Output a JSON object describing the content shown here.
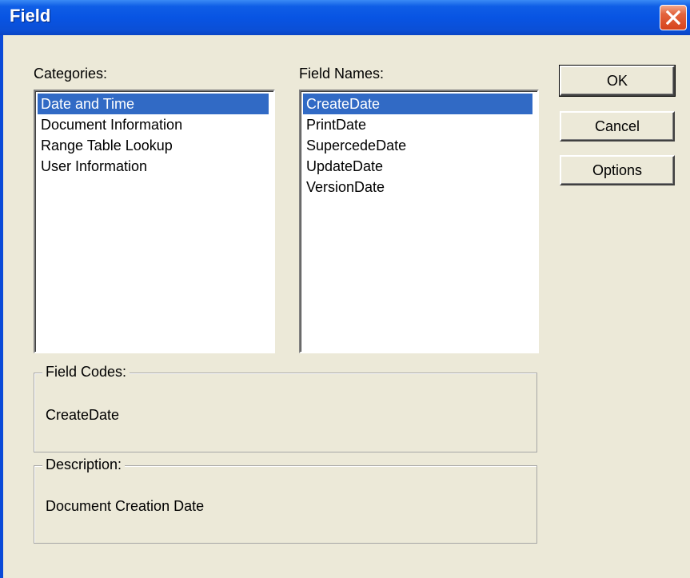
{
  "window": {
    "title": "Field",
    "titlebar_color": "#0a4ad8",
    "close_icon": "close-icon"
  },
  "categories": {
    "label": "Categories:",
    "items": [
      "Date and Time",
      "Document Information",
      "Range Table Lookup",
      "User Information"
    ],
    "selected": "Date and Time"
  },
  "field_names": {
    "label": "Field Names:",
    "items": [
      "CreateDate",
      "PrintDate",
      "SupercedeDate",
      "UpdateDate",
      "VersionDate"
    ],
    "selected": "CreateDate"
  },
  "buttons": {
    "ok": "OK",
    "cancel": "Cancel",
    "options": "Options"
  },
  "field_codes": {
    "label": "Field Codes:",
    "value": "CreateDate"
  },
  "description": {
    "label": "Description:",
    "value": "Document Creation Date"
  },
  "colors": {
    "selection": "#316ac5",
    "dialog_face": "#ece9d8"
  }
}
